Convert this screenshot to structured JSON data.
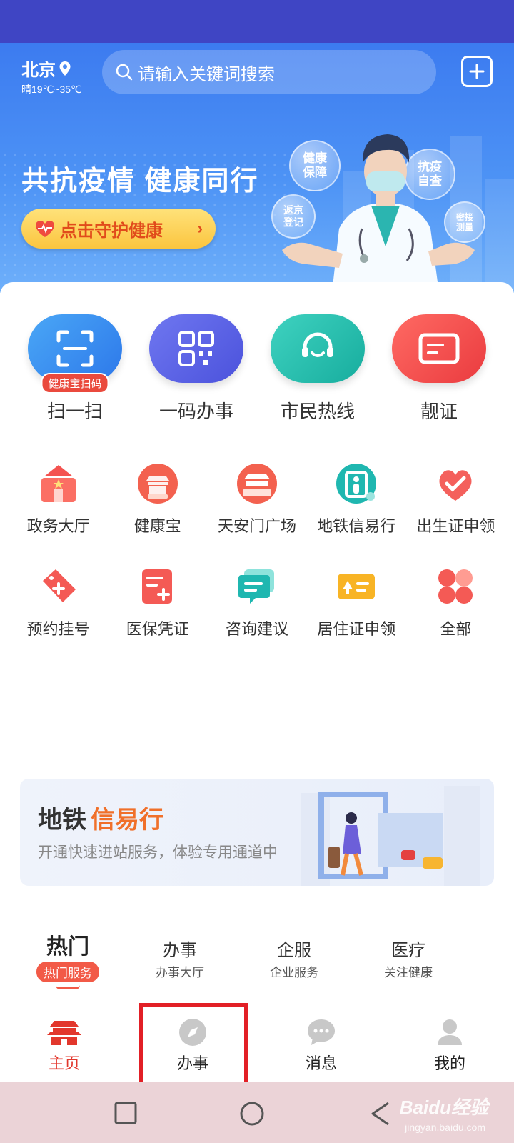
{
  "header": {
    "city": "北京",
    "weather": "晴19℃~35℃",
    "search_placeholder": "请输入关键词搜索"
  },
  "hero": {
    "title": "共抗疫情  健康同行",
    "cta_label": "点击守护健康",
    "bubbles": [
      "健康保障",
      "抗疫自查",
      "返京登记",
      "密接测量"
    ]
  },
  "quick_actions": [
    {
      "label": "扫一扫",
      "badge": "健康宝扫码",
      "color": "#3a8cf0",
      "icon": "scan-icon"
    },
    {
      "label": "一码办事",
      "color": "#5b63e8",
      "icon": "qr-code-icon"
    },
    {
      "label": "市民热线",
      "color": "#22bfae",
      "icon": "headset-icon"
    },
    {
      "label": "靓证",
      "color": "#f24e4a",
      "icon": "id-card-icon"
    }
  ],
  "services": [
    {
      "label": "政务大厅",
      "icon": "government-hall-icon"
    },
    {
      "label": "健康宝",
      "icon": "health-treasure-icon"
    },
    {
      "label": "天安门广场",
      "icon": "tiananmen-icon"
    },
    {
      "label": "地铁信易行",
      "icon": "subway-gate-icon"
    },
    {
      "label": "出生证申领",
      "icon": "birth-certificate-icon"
    },
    {
      "label": "预约挂号",
      "icon": "medical-tag-icon"
    },
    {
      "label": "医保凭证",
      "icon": "medical-insurance-icon"
    },
    {
      "label": "咨询建议",
      "icon": "chat-icon"
    },
    {
      "label": "居住证申领",
      "icon": "residence-card-icon"
    },
    {
      "label": "全部",
      "icon": "all-apps-icon"
    }
  ],
  "banner": {
    "title_part1": "地铁",
    "title_part2": "信易行",
    "subtitle": "开通快速进站服务，体验专用通道中"
  },
  "tabs": [
    {
      "main": "热门",
      "sub": "热门服务",
      "active": true
    },
    {
      "main": "办事",
      "sub": "办事大厅"
    },
    {
      "main": "企服",
      "sub": "企业服务"
    },
    {
      "main": "医疗",
      "sub": "关注健康"
    }
  ],
  "bottom_nav": [
    {
      "label": "主页",
      "icon": "home-temple-icon",
      "active": true
    },
    {
      "label": "办事",
      "icon": "compass-icon"
    },
    {
      "label": "消息",
      "icon": "message-icon"
    },
    {
      "label": "我的",
      "icon": "profile-icon"
    }
  ],
  "watermark": {
    "text": "Baidu经验",
    "sub": "jingyan.baidu.com"
  }
}
